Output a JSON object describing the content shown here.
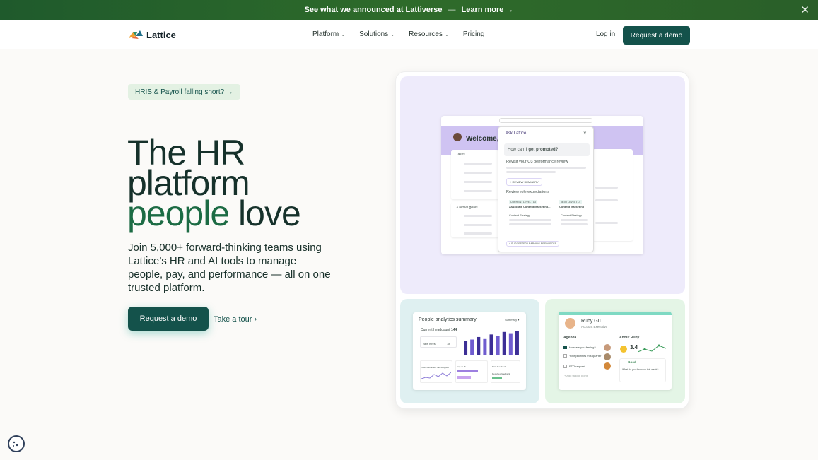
{
  "announcement": {
    "text": "See what we announced at Lattiverse",
    "dash": "—",
    "link": "Learn more →",
    "close": "✕"
  },
  "nav": {
    "logo": "Lattice",
    "menu": [
      "Platform",
      "Solutions",
      "Resources",
      "Pricing"
    ],
    "chevron": "⌄",
    "login": "Log in",
    "cta": "Request a demo"
  },
  "hero": {
    "pill": "HRIS & Payroll falling short? →",
    "headline_line1": "The HR",
    "headline_line2": "platform",
    "headline_green": "people",
    "headline_end": " love",
    "subtext": "Join 5,000+ forward-thinking teams using Lattice’s HR and AI tools to manage people, pay, and performance — all on one trusted platform.",
    "cta_primary": "Request a demo",
    "cta_secondary": "Take a tour ›"
  },
  "mock_ai": {
    "welcome": "Welcome,",
    "tasks": "Tasks",
    "goals": "3 active goals",
    "ask": "Ask Lattice",
    "close": "×",
    "question_prefix": "How can ",
    "question_bold": "I get promoted?",
    "review": "Revisit your Q3 performance review",
    "review_summary": "+ REVIEW SUMMARY",
    "expectations": "Review role expectations",
    "current_level": "CURRENT LEVEL • L3",
    "next_level": "NEXT LEVEL • L4",
    "current_role": "Associate Content Marketing...",
    "next_role": "Content Marketing",
    "strategy_a": "Content Strategy",
    "strategy_b": "Content Strategy",
    "resources": "+ SUGGESTED LEARNING RESOURCES"
  },
  "mock_analytics": {
    "title": "People analytics summary",
    "dropdown": "Summary ▾",
    "headcount_label": "Current headcount",
    "headcount": "144",
    "new_hires": "New hires",
    "new_hires_value": "18",
    "bar_values": [
      55,
      60,
      70,
      62,
      80,
      75,
      90,
      85,
      95
    ],
    "tag1": "Team sentiment has dropped",
    "tag2": "Eng vs IT",
    "tag3": "Start feedback",
    "tag4": "Inbox",
    "tag5": "Received feedback"
  },
  "mock_profile": {
    "name": "Ruby Gu",
    "role": "Account Executive",
    "agenda": "Agenda",
    "about": "About Ruby",
    "item1": "How are you feeling?",
    "item2": "Your priorities this quarter",
    "item3": "PTO request",
    "add": "+ Add talking point",
    "score": "3.4",
    "good": "Good",
    "question": "What do you focus on this week?"
  },
  "colors": {
    "brand": "#14524b",
    "accent_green": "#1c6b44",
    "announce_bg": "#2e6b2a",
    "purple_panel": "#eeebfb",
    "teal_panel": "#dff0f1",
    "green_panel": "#e4f5e6"
  },
  "icons": [
    "close-icon",
    "lattice-logo-icon",
    "chevron-down-icon",
    "arrow-right-icon",
    "cookie-icon"
  ]
}
